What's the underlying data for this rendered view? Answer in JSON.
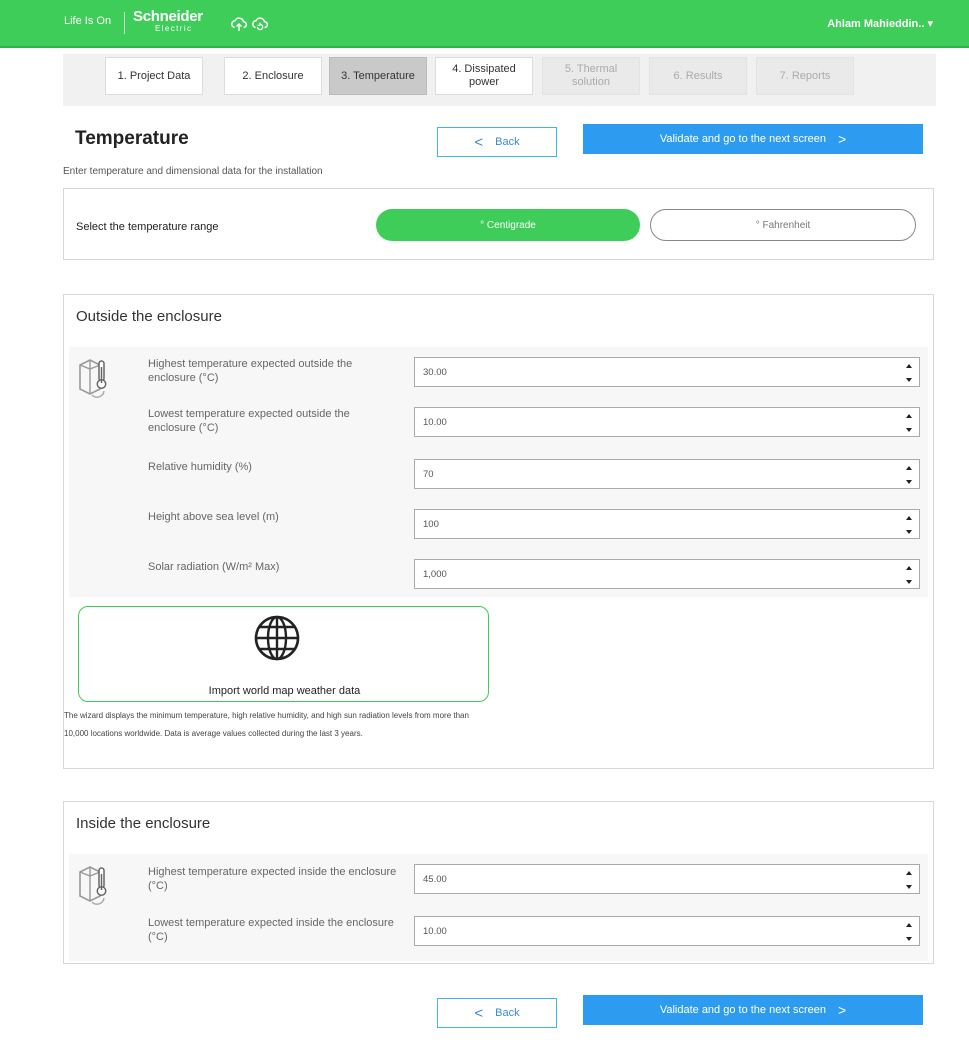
{
  "header": {
    "tagline": "Life Is On",
    "brand_name": "Schneider",
    "brand_sub": "Electric",
    "user_name": "Ahlam Mahieddin..",
    "user_chevron": "▾",
    "accent": "#3dcd58"
  },
  "steps": [
    {
      "label": "1. Project Data",
      "state": "normal"
    },
    {
      "label": "2. Enclosure",
      "state": "normal"
    },
    {
      "label": "3. Temperature",
      "state": "active"
    },
    {
      "label": "4. Dissipated power",
      "state": "normal"
    },
    {
      "label": "5. Thermal solution",
      "state": "disabled"
    },
    {
      "label": "6. Results",
      "state": "disabled"
    },
    {
      "label": "7. Reports",
      "state": "disabled"
    }
  ],
  "page": {
    "title": "Temperature",
    "subtitle": "Enter temperature and dimensional data for the installation",
    "back_label": "Back",
    "next_label": "Validate and go to the next screen",
    "chevron_left": "<",
    "chevron_right": ">"
  },
  "temperature_range": {
    "label": "Select the temperature range",
    "centigrade": "° Centigrade",
    "fahrenheit": "° Fahrenheit",
    "selected": "centigrade"
  },
  "outside": {
    "title": "Outside the enclosure",
    "fields": [
      {
        "label": "Highest temperature expected outside the enclosure (°C)",
        "value": "30.00"
      },
      {
        "label": "Lowest temperature expected outside the enclosure (°C)",
        "value": "10.00"
      },
      {
        "label": "Relative humidity (%)",
        "value": "70"
      },
      {
        "label": "Height above sea level (m)",
        "value": "100"
      },
      {
        "label": "Solar radiation (W/m² Max)",
        "value": "1,000"
      }
    ],
    "map_button_label": "Import world map weather data",
    "map_note": "The wizard displays the minimum temperature, high relative humidity, and high sun radiation levels from more than 10,000 locations worldwide. Data is average values collected during the last 3 years."
  },
  "inside": {
    "title": "Inside the enclosure",
    "fields": [
      {
        "label": "Highest temperature expected inside the enclosure (°C)",
        "value": "45.00"
      },
      {
        "label": "Lowest temperature expected inside the enclosure (°C)",
        "value": "10.00"
      }
    ]
  },
  "icons": {
    "cloud_1": "cloud-sync-icon",
    "cloud_2": "cloud-refresh-icon",
    "enclosure": "enclosure-thermometer-icon",
    "globe": "globe-icon"
  }
}
